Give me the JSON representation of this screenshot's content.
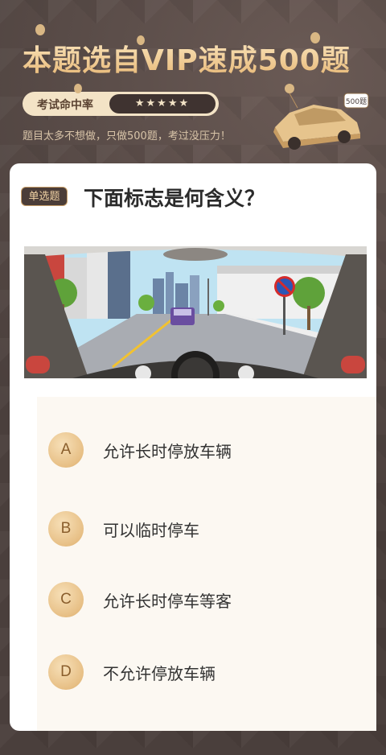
{
  "header": {
    "title": "本题选自VIP速成500题",
    "rate_label": "考试命中率",
    "rate_stars": "★★★★★",
    "tagline": "题目太多不想做，只做500题，考过没压力！",
    "car_badge": "500题"
  },
  "question": {
    "type_badge": "单选题",
    "text": "下面标志是何含义？",
    "image_icon": "no-long-term-parking-sign",
    "options": [
      {
        "letter": "A",
        "text": "允许长时停放车辆"
      },
      {
        "letter": "B",
        "text": "可以临时停车"
      },
      {
        "letter": "C",
        "text": "允许长时停车等客"
      },
      {
        "letter": "D",
        "text": "不允许停放车辆"
      }
    ]
  },
  "colors": {
    "background": "#4a3f3c",
    "gold": "#e7b775",
    "card": "#ffffff",
    "options_panel": "#fcf8f2"
  }
}
